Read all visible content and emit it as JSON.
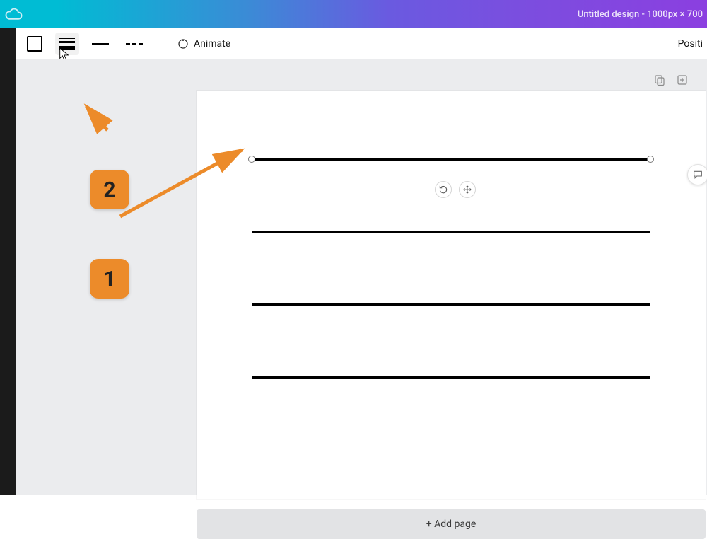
{
  "header": {
    "title": "Untitled design - 1000px × 700"
  },
  "toolbar": {
    "animate_label": "Animate",
    "position_label": "Positi"
  },
  "page_actions": {
    "copy_tooltip": "Duplicate page",
    "add_tooltip": "Add page"
  },
  "canvas": {
    "add_page_label": "+ Add page",
    "line_positions": [
      95,
      198,
      301,
      404
    ]
  },
  "annotations": {
    "callout1": "1",
    "callout2": "2"
  },
  "colors": {
    "callout_bg": "#ec8b2a"
  },
  "icons": {
    "cloud": "cloud-save-icon",
    "color": "line-color-icon",
    "weight": "line-weight-icon",
    "solid": "line-style-solid-icon",
    "dashed": "line-style-dashed-icon",
    "animate": "animate-icon",
    "copy": "duplicate-page-icon",
    "add": "add-page-icon",
    "rotate": "rotate-icon",
    "move": "move-icon",
    "comment": "comment-icon"
  }
}
